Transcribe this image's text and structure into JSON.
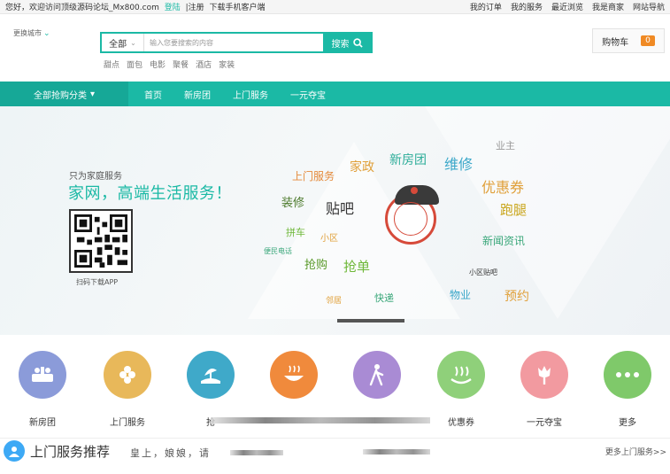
{
  "topbar": {
    "welcome": "您好，欢迎访问顶级源码论坛_Mx800.com",
    "login": "登陆",
    "register": "|注册",
    "download": "下载手机客户端",
    "links": [
      "我的订单",
      "我的服务",
      "最近浏览",
      "我是商家",
      "网站导航"
    ]
  },
  "header": {
    "city": "更换城市",
    "search_scope": "全部",
    "search_placeholder": "输入您要搜索的内容",
    "search_button": "搜索",
    "hotwords": [
      "甜点",
      "面包",
      "电影",
      "聚餐",
      "酒店",
      "家装"
    ],
    "cart_label": "购物车",
    "cart_count": "0"
  },
  "nav": {
    "category": "全部抢购分类",
    "items": [
      "首页",
      "新房团",
      "上门服务",
      "一元夺宝"
    ]
  },
  "banner": {
    "small": "只为家庭服务",
    "big": "家网，高端生活服务！",
    "qr_caption": "扫码下载APP",
    "words": [
      "上门服务",
      "家政",
      "新房团",
      "维修",
      "业主",
      "优惠券",
      "装修",
      "贴吧",
      "跑腿",
      "拼车",
      "小区",
      "新闻资讯",
      "便民电话",
      "抢购",
      "抢单",
      "小区贴吧",
      "物业",
      "预约",
      "邻居",
      "快递"
    ]
  },
  "services": {
    "items": [
      {
        "label": "新房团",
        "color": "#8b9bd9"
      },
      {
        "label": "上门服务",
        "color": "#e8b85a"
      },
      {
        "label": "抢",
        "color": "#3fa9c9"
      },
      {
        "label": "",
        "color": "#f08a3c"
      },
      {
        "label": "",
        "color": "#a98bd4"
      },
      {
        "label": "优惠券",
        "color": "#8fd07a"
      },
      {
        "label": "一元夺宝",
        "color": "#f29aa0"
      },
      {
        "label": "更多",
        "color": "#7fc96a"
      }
    ]
  },
  "recommend": {
    "title": "上门服务推荐",
    "tagline": "皇上，娘娘，请",
    "more": "更多上门服务>>"
  },
  "colors": {
    "accent": "#1bb9a5",
    "cart_badge": "#f08a24"
  }
}
